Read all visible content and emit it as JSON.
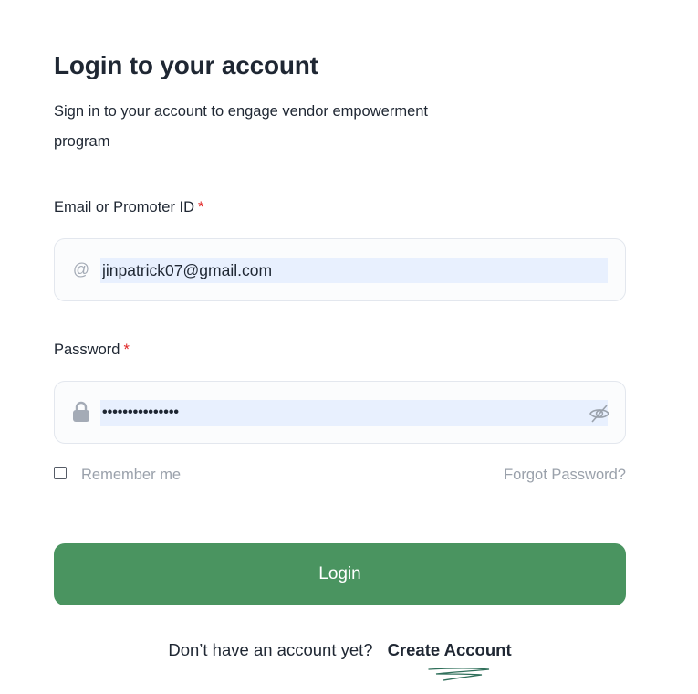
{
  "header": {
    "title": "Login to your account",
    "subtitle": "Sign in to your account to engage vendor empowerment program"
  },
  "form": {
    "email": {
      "label": "Email or Promoter ID",
      "required_mark": "*",
      "icon": "at-icon",
      "value": "jinpatrick07@gmail.com"
    },
    "password": {
      "label": "Password",
      "required_mark": "*",
      "icon": "lock-icon",
      "masked_value": "•••••••••••••••",
      "toggle_icon": "eye-off-icon"
    },
    "remember_me": {
      "label": "Remember me",
      "checked": false
    },
    "forgot_password": "Forgot Password?",
    "submit_label": "Login"
  },
  "footer": {
    "prompt": "Don’t have an account yet?",
    "create_account": "Create Account"
  },
  "colors": {
    "primary": "#4a9460",
    "required": "#e02424",
    "muted": "#9aa1ab",
    "autofill": "#e8f0fe"
  }
}
